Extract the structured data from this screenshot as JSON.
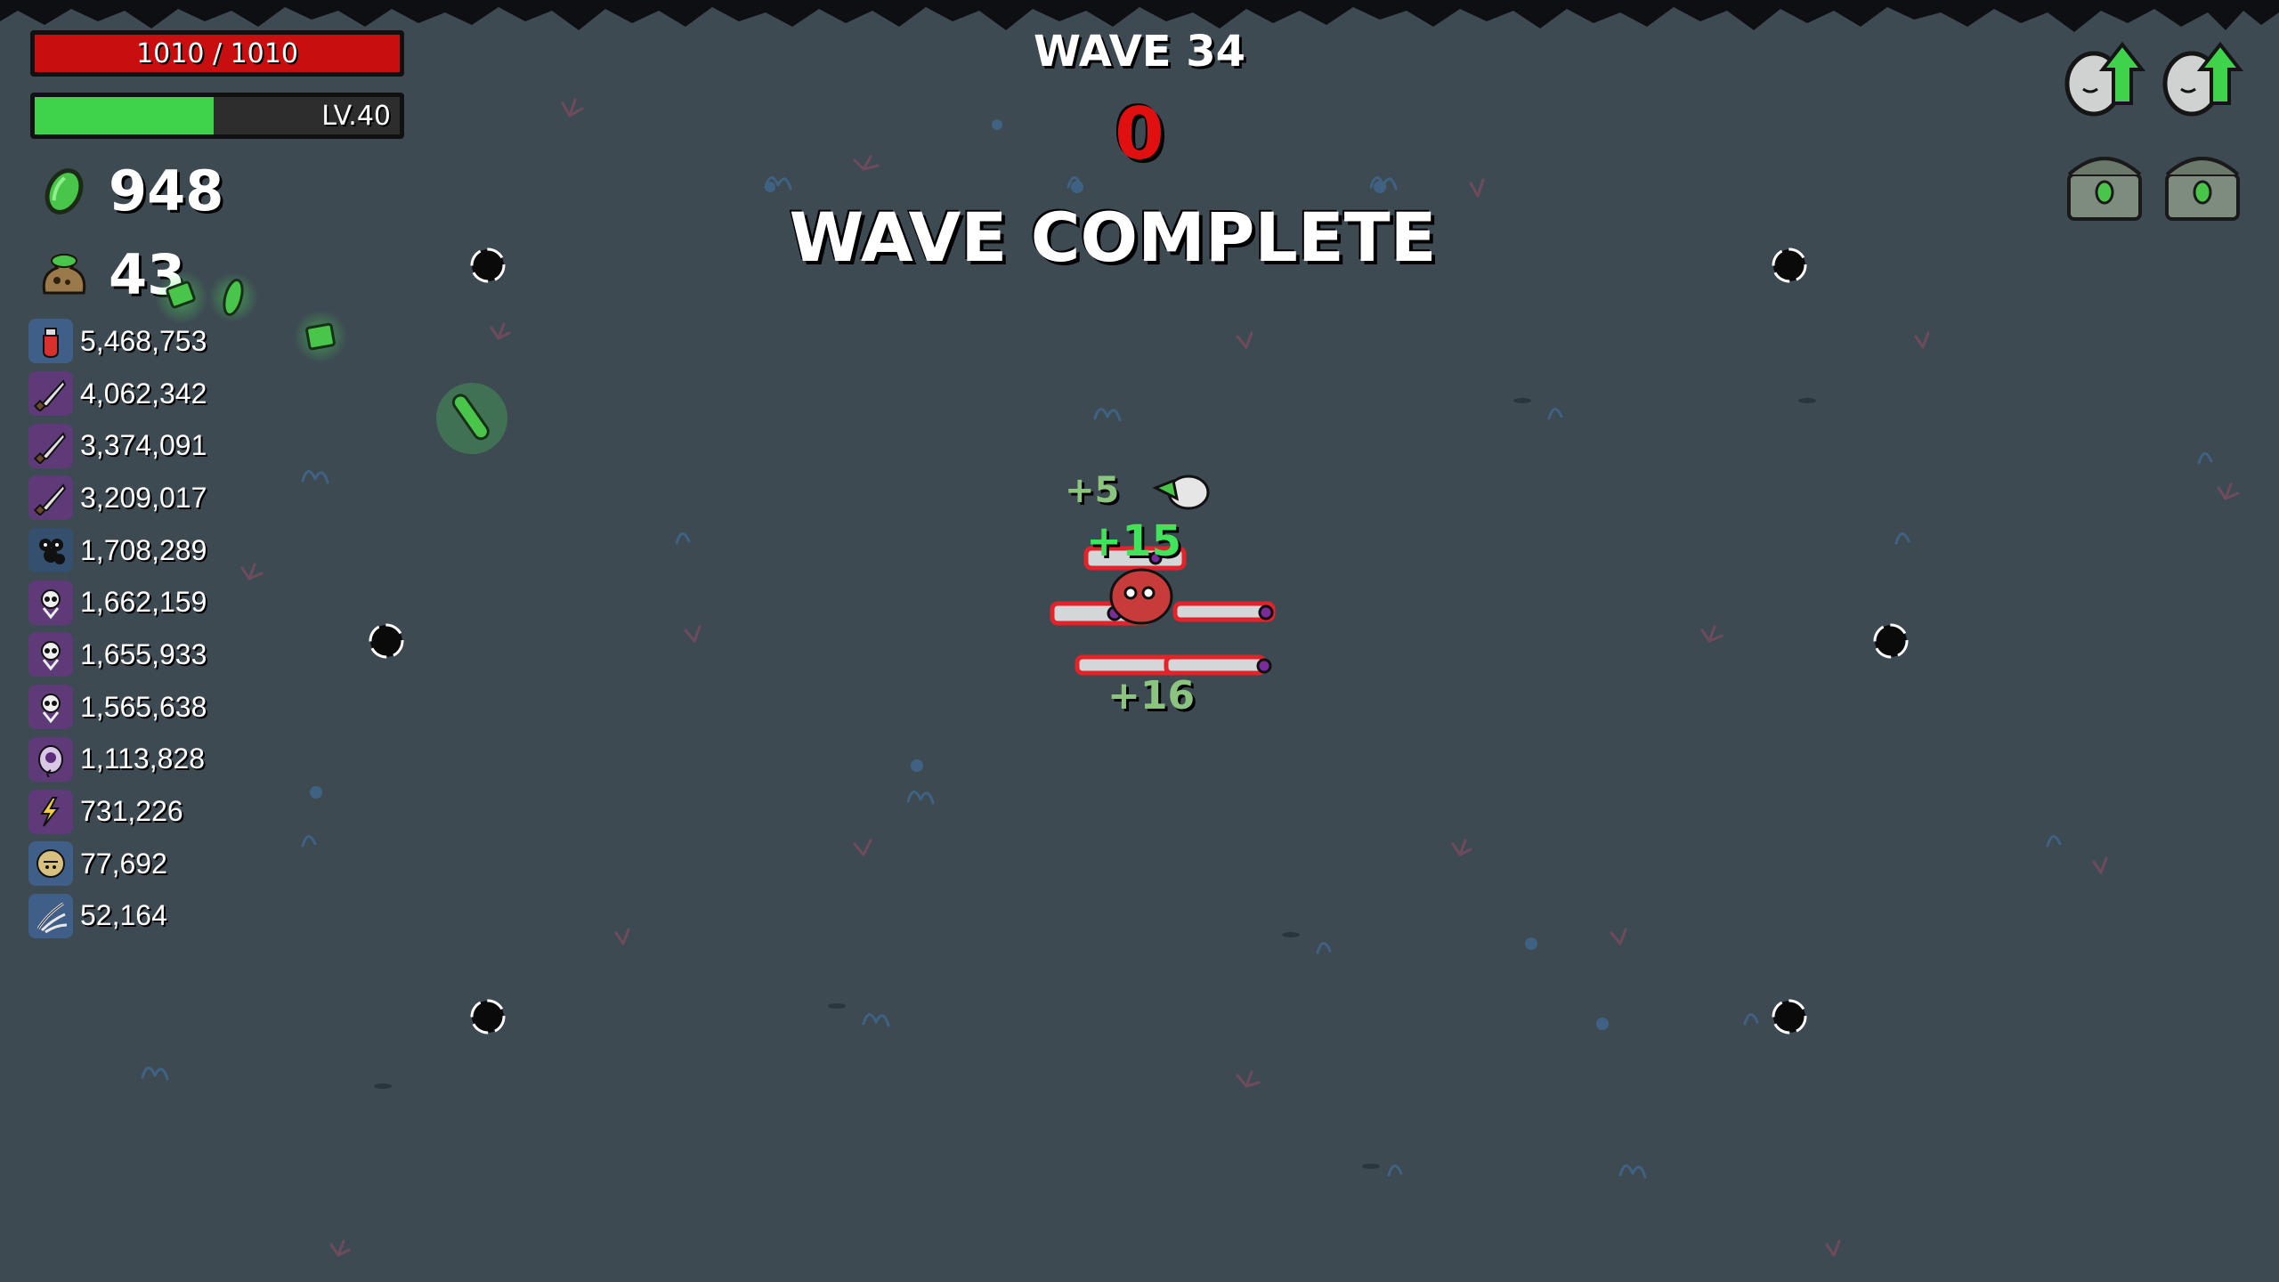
{
  "hud": {
    "hp_text": "1010 / 1010",
    "level_text": "LV.40",
    "xp_fraction": 0.49,
    "materials": "948",
    "bag": "43"
  },
  "wave": {
    "title": "WAVE 34",
    "timer": "0",
    "complete": "WAVE COMPLETE"
  },
  "damage": [
    {
      "value": "5,468,753",
      "icon": "potion-icon",
      "color": "#3f5f88"
    },
    {
      "value": "4,062,342",
      "icon": "knife-icon",
      "color": "#5e3a78"
    },
    {
      "value": "3,374,091",
      "icon": "knife-icon",
      "color": "#5e3a78"
    },
    {
      "value": "3,209,017",
      "icon": "knife-icon",
      "color": "#5e3a78"
    },
    {
      "value": "1,708,289",
      "icon": "cluster-icon",
      "color": "#34506e"
    },
    {
      "value": "1,662,159",
      "icon": "skull-icon",
      "color": "#5e3a78"
    },
    {
      "value": "1,655,933",
      "icon": "skull-icon",
      "color": "#5e3a78"
    },
    {
      "value": "1,565,638",
      "icon": "skull-icon",
      "color": "#5e3a78"
    },
    {
      "value": "1,113,828",
      "icon": "eye-icon",
      "color": "#5e3a78"
    },
    {
      "value": "731,226",
      "icon": "lightning-icon",
      "color": "#5e3a78"
    },
    {
      "value": "77,692",
      "icon": "coin-face-icon",
      "color": "#3f5f88"
    },
    {
      "value": "52,164",
      "icon": "claw-icon",
      "color": "#3f5f88"
    }
  ],
  "floats": [
    "+15",
    "+16",
    "+5"
  ],
  "colors": {
    "background": "#3d4a52",
    "hp": "#c80e0e",
    "xp": "#3ed34a",
    "timer": "#e01010",
    "pickup": "#41e35a"
  }
}
